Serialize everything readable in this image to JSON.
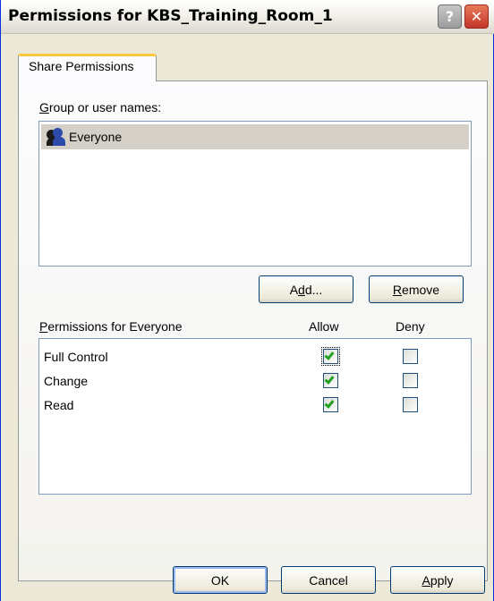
{
  "window": {
    "title": "Permissions for KBS_Training_Room_1",
    "help_label": "?",
    "close_label": "✕"
  },
  "tabs": [
    {
      "label": "Share Permissions",
      "selected": true
    }
  ],
  "groups_section": {
    "label": "Group or user names:",
    "label_hotkey": "G",
    "label_rest": "roup or user names:",
    "items": [
      {
        "name": "Everyone",
        "icon": "group-users-icon",
        "selected": true
      }
    ]
  },
  "buttons": {
    "add": {
      "label": "Add...",
      "pre": "A",
      "hotkey": "d",
      "post": "d..."
    },
    "remove": {
      "label": "Remove",
      "hotkey": "R",
      "post": "emove"
    },
    "ok": {
      "label": "OK"
    },
    "cancel": {
      "label": "Cancel"
    },
    "apply": {
      "label": "Apply",
      "hotkey": "A",
      "post": "pply"
    }
  },
  "permissions": {
    "label": "Permissions for Everyone",
    "label_hotkey": "P",
    "label_rest": "ermissions for Everyone",
    "allow_header": "Allow",
    "deny_header": "Deny",
    "rows": [
      {
        "name": "Full Control",
        "allow": true,
        "deny": false
      },
      {
        "name": "Change",
        "allow": true,
        "deny": false
      },
      {
        "name": "Read",
        "allow": true,
        "deny": false
      }
    ]
  },
  "colors": {
    "check": "#21a121",
    "tab_highlight": "#ffc83c",
    "selection": "#d4d0c8"
  }
}
